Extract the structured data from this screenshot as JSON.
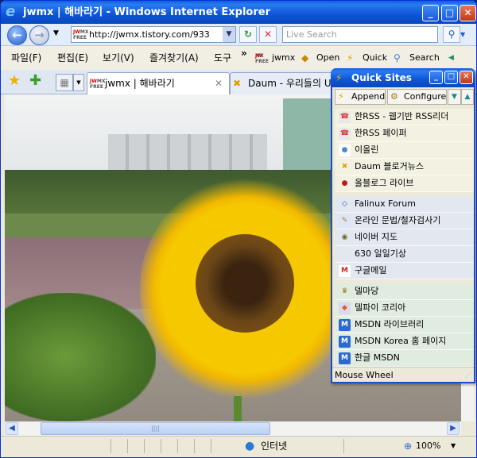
{
  "window": {
    "title": "jwmx | 해바라기 - Windows Internet Explorer",
    "min": "_",
    "max": "□",
    "close": "✕"
  },
  "address": {
    "url": "http://jwmx.tistory.com/933",
    "search_placeholder": "Live Search",
    "favicon_text": "JWMX FREE"
  },
  "menu": {
    "items": [
      "파일(F)",
      "편집(E)",
      "보기(V)",
      "즐겨찾기(A)",
      "도구"
    ],
    "more": "»",
    "links": [
      "jwmx",
      "Open",
      "Quick",
      "Search"
    ]
  },
  "tabs": [
    {
      "label": "jwmx | 해바라기",
      "close": "✕",
      "active": true
    },
    {
      "label": "Daum - 우리들의 U",
      "active": false
    }
  ],
  "status": {
    "zone": "인터넷",
    "zoom": "100%"
  },
  "quick_sites": {
    "title": "Quick Sites",
    "append": "Append",
    "configure": "Configure",
    "groups": [
      {
        "color": "#f3f2e2",
        "items": [
          {
            "label": "한RSS - 웹기반 RSS리더",
            "icon": "hanrss-icon"
          },
          {
            "label": "한RSS 페이퍼",
            "icon": "hanrss-icon"
          },
          {
            "label": "이올린",
            "icon": "chat-bubble-icon"
          },
          {
            "label": "Daum 블로거뉴스",
            "icon": "daum-icon"
          },
          {
            "label": "올블로그 라이브",
            "icon": "allblog-icon"
          }
        ]
      },
      {
        "color": "#e3e7f0",
        "items": [
          {
            "label": "Falinux Forum",
            "icon": "code-brackets-icon"
          },
          {
            "label": "온라인 문법/철자검사기",
            "icon": "edit-icon"
          },
          {
            "label": "네이버 지도",
            "icon": "naver-map-icon"
          },
          {
            "label": "630 일일기상",
            "icon": ""
          },
          {
            "label": "구글메일",
            "icon": "gmail-icon"
          }
        ]
      },
      {
        "color": "#e1ece0",
        "items": [
          {
            "label": "델마당",
            "icon": "trophy-icon"
          },
          {
            "label": "델파이 코리아",
            "icon": "delphi-icon"
          },
          {
            "label": "MSDN 라이브러리",
            "icon": "msdn-icon"
          },
          {
            "label": "MSDN Korea 홈 페이지",
            "icon": "msdn-icon"
          },
          {
            "label": "한글 MSDN",
            "icon": "msdn-icon"
          }
        ]
      }
    ],
    "status": "Mouse Wheel"
  }
}
